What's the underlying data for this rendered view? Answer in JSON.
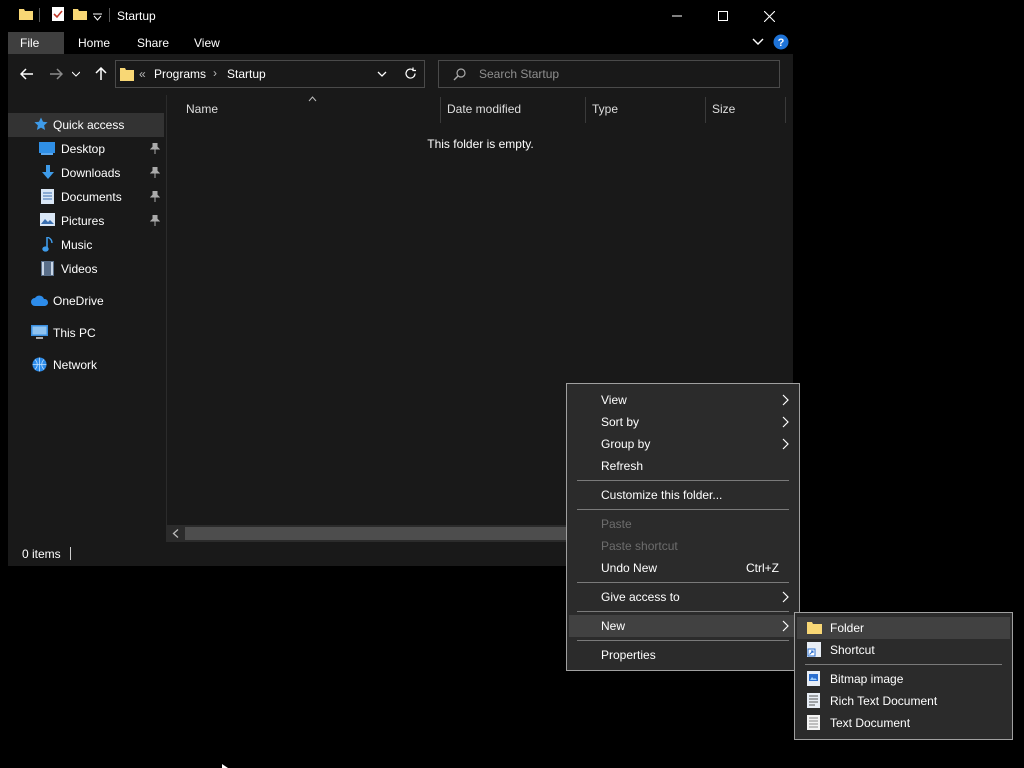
{
  "window": {
    "title": "Startup"
  },
  "ribbon": {
    "tabs": [
      "File",
      "Home",
      "Share",
      "View"
    ]
  },
  "address": {
    "overflow": "«",
    "crumbs": [
      "Programs",
      "Startup"
    ],
    "separator": "›"
  },
  "search": {
    "placeholder": "Search Startup"
  },
  "sidebar": {
    "quick_access": "Quick access",
    "items": [
      "Desktop",
      "Downloads",
      "Documents",
      "Pictures",
      "Music",
      "Videos"
    ],
    "onedrive": "OneDrive",
    "this_pc": "This PC",
    "network": "Network"
  },
  "columns": [
    "Name",
    "Date modified",
    "Type",
    "Size"
  ],
  "content": {
    "empty_message": "This folder is empty."
  },
  "status": {
    "items": "0 items"
  },
  "context_menu": {
    "view": "View",
    "sort_by": "Sort by",
    "group_by": "Group by",
    "refresh": "Refresh",
    "customize": "Customize this folder...",
    "paste": "Paste",
    "paste_shortcut": "Paste shortcut",
    "undo_new": "Undo New",
    "undo_shortcut": "Ctrl+Z",
    "give_access": "Give access to",
    "new": "New",
    "properties": "Properties"
  },
  "new_submenu": {
    "folder": "Folder",
    "shortcut": "Shortcut",
    "bitmap": "Bitmap image",
    "rich_text": "Rich Text Document",
    "text": "Text Document"
  },
  "colors": {
    "window_bg": "#191919",
    "titlebar_bg": "#000000",
    "menu_bg": "#2b2b2b",
    "highlight": "#414141",
    "folder_yellow": "#f8d775",
    "accent_blue": "#1e90ff"
  }
}
